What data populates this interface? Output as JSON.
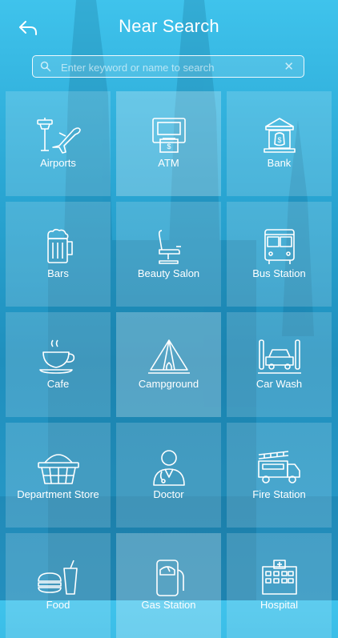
{
  "header": {
    "title": "Near Search",
    "back_icon": "back-arrow-icon"
  },
  "search": {
    "placeholder": "Enter keyword or name to search",
    "value": "",
    "clear_glyph": "✕"
  },
  "categories": [
    {
      "label": "Airports",
      "icon": "airport-icon"
    },
    {
      "label": "ATM",
      "icon": "atm-icon"
    },
    {
      "label": "Bank",
      "icon": "bank-icon"
    },
    {
      "label": "Bars",
      "icon": "beer-mug-icon"
    },
    {
      "label": "Beauty Salon",
      "icon": "salon-chair-icon"
    },
    {
      "label": "Bus Station",
      "icon": "bus-icon"
    },
    {
      "label": "Cafe",
      "icon": "coffee-cup-icon"
    },
    {
      "label": "Campground",
      "icon": "tent-icon"
    },
    {
      "label": "Car Wash",
      "icon": "car-wash-icon"
    },
    {
      "label": "Department Store",
      "icon": "shopping-basket-icon"
    },
    {
      "label": "Doctor",
      "icon": "doctor-icon"
    },
    {
      "label": "Fire Station",
      "icon": "fire-truck-icon"
    },
    {
      "label": "Food",
      "icon": "fast-food-icon"
    },
    {
      "label": "Gas Station",
      "icon": "fuel-pump-icon"
    },
    {
      "label": "Hospital",
      "icon": "hospital-icon"
    }
  ],
  "colors": {
    "accent": "#2aa7d4",
    "text": "#ffffff"
  }
}
